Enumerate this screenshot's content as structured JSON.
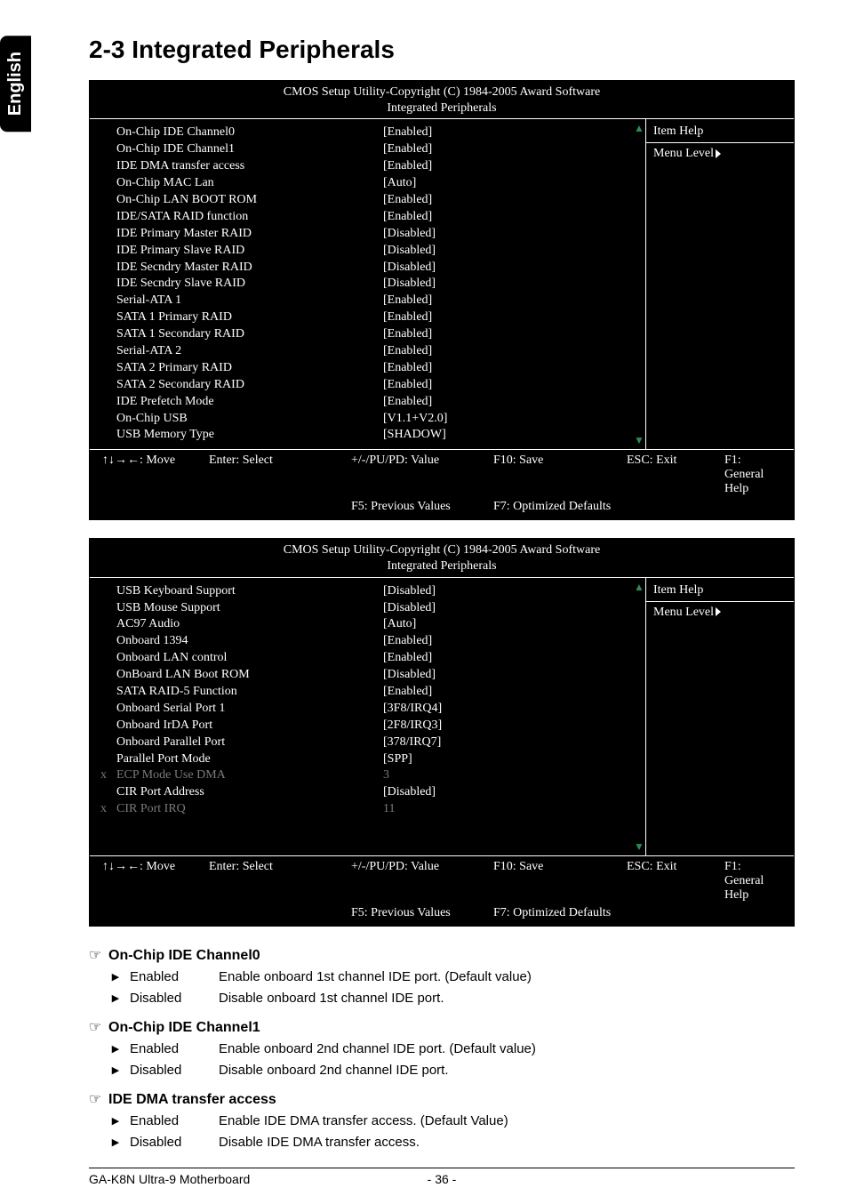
{
  "language_tab": "English",
  "page_title": "2-3    Integrated Peripherals",
  "bios_header_line1": "CMOS Setup Utility-Copyright (C) 1984-2005 Award Software",
  "bios_header_line2": "Integrated Peripherals",
  "bios1": {
    "rows": [
      {
        "label": "On-Chip IDE Channel0",
        "value": "[Enabled]"
      },
      {
        "label": "On-Chip IDE Channel1",
        "value": "[Enabled]"
      },
      {
        "label": "IDE DMA transfer access",
        "value": "[Enabled]"
      },
      {
        "label": "On-Chip MAC Lan",
        "value": "[Auto]"
      },
      {
        "label": "On-Chip LAN BOOT ROM",
        "value": "[Enabled]"
      },
      {
        "label": "IDE/SATA RAID function",
        "value": "[Enabled]"
      },
      {
        "label": "IDE Primary Master RAID",
        "value": "[Disabled]"
      },
      {
        "label": "IDE Primary Slave RAID",
        "value": "[Disabled]"
      },
      {
        "label": "IDE Secndry Master RAID",
        "value": "[Disabled]"
      },
      {
        "label": "IDE Secndry Slave RAID",
        "value": "[Disabled]"
      },
      {
        "label": "Serial-ATA 1",
        "value": "[Enabled]"
      },
      {
        "label": "SATA 1 Primary RAID",
        "value": "[Enabled]"
      },
      {
        "label": "SATA 1 Secondary RAID",
        "value": "[Enabled]"
      },
      {
        "label": "Serial-ATA 2",
        "value": "[Enabled]"
      },
      {
        "label": "SATA 2 Primary RAID",
        "value": "[Enabled]"
      },
      {
        "label": "SATA 2 Secondary RAID",
        "value": "[Enabled]"
      },
      {
        "label": "IDE Prefetch Mode",
        "value": "[Enabled]"
      },
      {
        "label": "On-Chip USB",
        "value": "[V1.1+V2.0]"
      },
      {
        "label": "USB Memory Type",
        "value": "[SHADOW]"
      }
    ]
  },
  "bios2": {
    "rows": [
      {
        "label": "USB Keyboard Support",
        "value": "[Disabled]",
        "dim": false
      },
      {
        "label": "USB Mouse Support",
        "value": "[Disabled]",
        "dim": false
      },
      {
        "label": "AC97 Audio",
        "value": "[Auto]",
        "dim": false
      },
      {
        "label": "Onboard 1394",
        "value": "[Enabled]",
        "dim": false
      },
      {
        "label": "Onboard LAN control",
        "value": "[Enabled]",
        "dim": false
      },
      {
        "label": "OnBoard LAN Boot ROM",
        "value": "[Disabled]",
        "dim": false
      },
      {
        "label": "SATA RAID-5 Function",
        "value": "[Enabled]",
        "dim": false
      },
      {
        "label": "Onboard Serial Port 1",
        "value": "[3F8/IRQ4]",
        "dim": false
      },
      {
        "label": "Onboard IrDA Port",
        "value": "[2F8/IRQ3]",
        "dim": false
      },
      {
        "label": "Onboard Parallel Port",
        "value": "[378/IRQ7]",
        "dim": false
      },
      {
        "label": "Parallel Port Mode",
        "value": "[SPP]",
        "dim": false
      },
      {
        "label": "ECP Mode Use DMA",
        "value": "3",
        "dim": true,
        "x": "x"
      },
      {
        "label": "CIR Port Address",
        "value": "[Disabled]",
        "dim": false
      },
      {
        "label": "CIR Port IRQ",
        "value": "11",
        "dim": true,
        "x": "x"
      }
    ]
  },
  "help_title": "Item Help",
  "help_menu_level": "Menu Level",
  "footer": {
    "move": "↑↓→←: Move",
    "enter": "Enter: Select",
    "value": "+/-/PU/PD: Value",
    "save": "F10: Save",
    "exit": "ESC: Exit",
    "general": "F1: General Help",
    "prev": "F5: Previous Values",
    "defaults": "F7: Optimized Defaults"
  },
  "descriptions": [
    {
      "title": "On-Chip IDE Channel0",
      "options": [
        {
          "name": "Enabled",
          "desc": "Enable onboard 1st channel IDE port. (Default value)"
        },
        {
          "name": "Disabled",
          "desc": "Disable onboard 1st channel IDE port."
        }
      ]
    },
    {
      "title": "On-Chip IDE Channel1",
      "options": [
        {
          "name": "Enabled",
          "desc": "Enable onboard 2nd channel IDE port. (Default value)"
        },
        {
          "name": "Disabled",
          "desc": "Disable onboard 2nd channel IDE port."
        }
      ]
    },
    {
      "title": "IDE DMA transfer access",
      "options": [
        {
          "name": "Enabled",
          "desc": "Enable IDE DMA transfer access. (Default Value)"
        },
        {
          "name": "Disabled",
          "desc": "Disable IDE DMA transfer access."
        }
      ]
    }
  ],
  "page_footer_left": "GA-K8N Ultra-9 Motherboard",
  "page_footer_center": "- 36 -"
}
